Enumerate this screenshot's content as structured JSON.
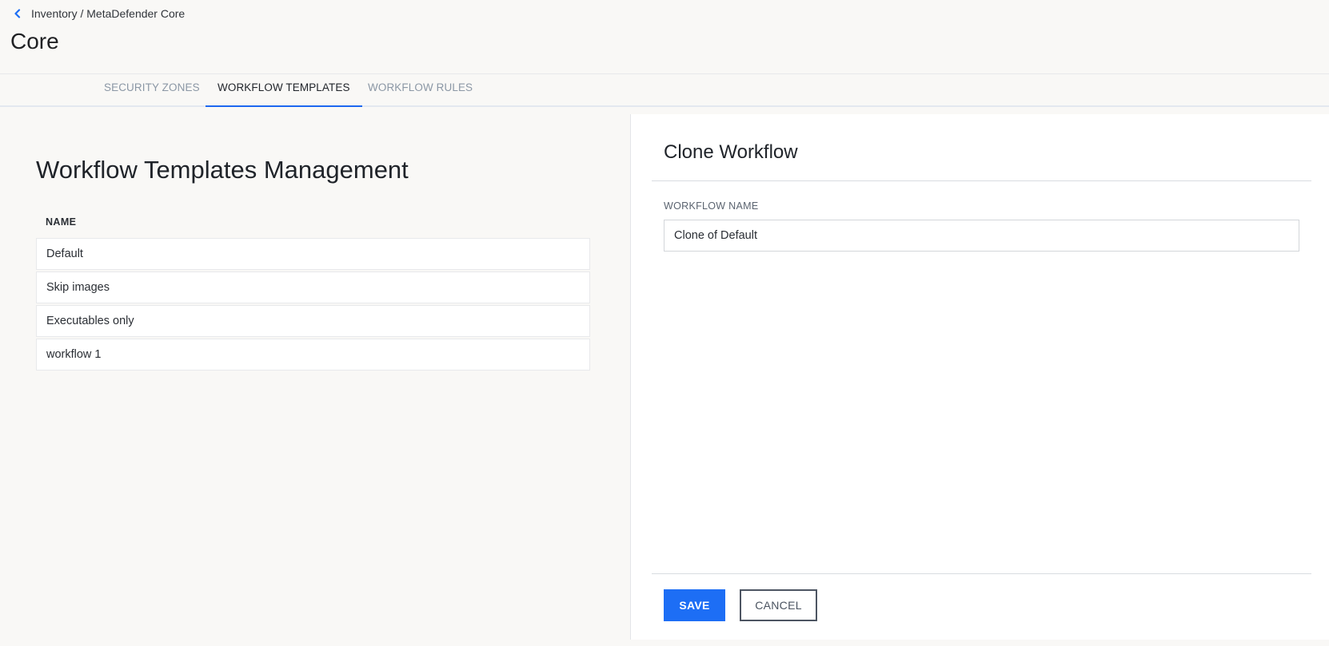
{
  "breadcrumb": {
    "text": "Inventory / MetaDefender Core"
  },
  "page": {
    "title": "Core"
  },
  "tabs": [
    {
      "label": "SECURITY ZONES",
      "active": false
    },
    {
      "label": "WORKFLOW TEMPLATES",
      "active": true
    },
    {
      "label": "WORKFLOW RULES",
      "active": false
    }
  ],
  "management": {
    "title": "Workflow Templates Management",
    "column_header": "NAME",
    "rows": [
      "Default",
      "Skip images",
      "Executables only",
      "workflow 1"
    ]
  },
  "clone_panel": {
    "title": "Clone Workflow",
    "field_label": "WORKFLOW NAME",
    "field_value": "Clone of Default",
    "save_label": "SAVE",
    "cancel_label": "CANCEL"
  },
  "colors": {
    "accent": "#1d6ef5",
    "active_tab_underline": "#1d67f0",
    "background": "#f9f8f6",
    "panel": "#ffffff"
  },
  "icons": {
    "back": "chevron-left-icon"
  }
}
